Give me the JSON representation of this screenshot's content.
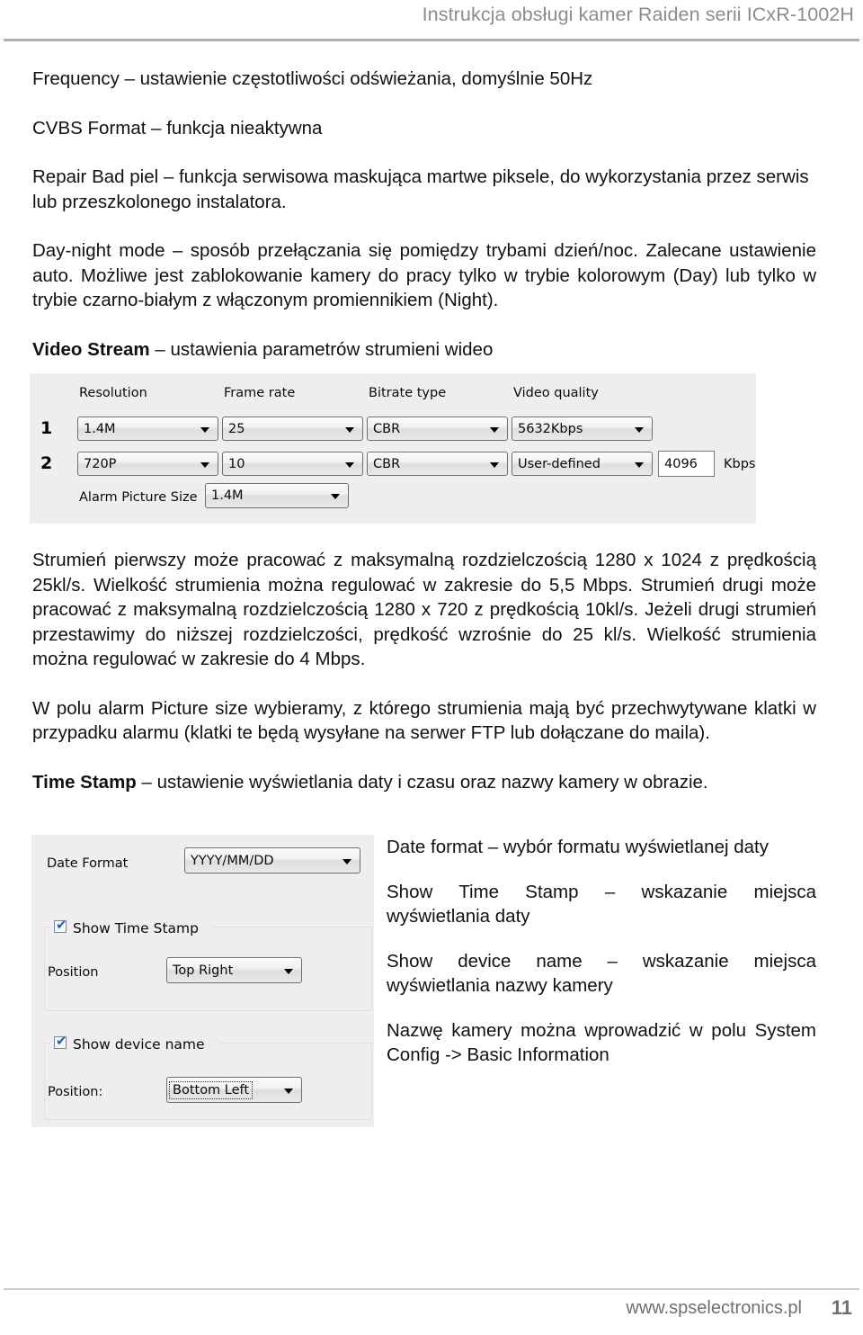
{
  "header": {
    "title": "Instrukcja obsługi kamer Raiden serii ICxR-1002H"
  },
  "body": {
    "p_frequency": "Frequency – ustawienie częstotliwości odświeżania, domyślnie 50Hz",
    "p_cvbs": "CVBS Format – funkcja nieaktywna",
    "p_repair": "Repair Bad piel – funkcja serwisowa maskująca martwe piksele, do wykorzystania przez serwis lub przeszkolonego instalatora.",
    "p_daynight": "Day-night mode – sposób przełączania się pomiędzy trybami dzień/noc. Zalecane ustawienie auto. Możliwe jest zablokowanie kamery do pracy tylko w trybie kolorowym (Day) lub tylko w trybie czarno-białym z włączonym promiennikiem (Night).",
    "video_stream_heading_bold": "Video Stream",
    "video_stream_heading_rest": " – ustawienia parametrów strumieni wideo",
    "p_streams": "Strumień pierwszy może pracować z maksymalną rozdzielczością 1280 x 1024 z prędkością 25kl/s. Wielkość strumienia można regulować w zakresie do 5,5 Mbps. Strumień drugi może pracować z maksymalną rozdzielczością 1280 x 720 z prędkością 10kl/s. Jeżeli drugi strumień przestawimy do niższej rozdzielczości, prędkość wzrośnie do 25 kl/s. Wielkość strumienia można regulować w zakresie do 4 Mbps.",
    "p_alarm_picture": "W polu alarm Picture size wybieramy, z którego strumienia mają być przechwytywane klatki w przypadku alarmu (klatki te będą wysyłane na serwer FTP lub dołączane do maila).",
    "time_stamp_heading_bold": "Time Stamp",
    "time_stamp_heading_rest": " – ustawienie wyświetlania daty i czasu oraz nazwy kamery w obrazie."
  },
  "video_stream_panel": {
    "columns": {
      "resolution": "Resolution",
      "frame_rate": "Frame rate",
      "bitrate_type": "Bitrate type",
      "video_quality": "Video quality"
    },
    "rows": [
      {
        "index": "1",
        "resolution": "1.4M",
        "frame_rate": "25",
        "bitrate_type": "CBR",
        "video_quality": "5632Kbps"
      },
      {
        "index": "2",
        "resolution": "720P",
        "frame_rate": "10",
        "bitrate_type": "CBR",
        "video_quality": "User-defined",
        "custom_bitrate": "4096",
        "custom_bitrate_unit": "Kbps"
      }
    ],
    "alarm_picture_size_label": "Alarm Picture Size",
    "alarm_picture_size_value": "1.4M"
  },
  "time_stamp_panel": {
    "date_format_label": "Date Format",
    "date_format_value": "YYYY/MM/DD",
    "show_time_stamp_label": "Show Time Stamp",
    "time_stamp_position_label": "Position",
    "time_stamp_position_value": "Top Right",
    "show_device_name_label": "Show device name",
    "device_name_position_label": "Position:",
    "device_name_position_value": "Bottom Left",
    "checkbox_tick": "✔"
  },
  "right_column": {
    "date_format_desc": "Date format – wybór formatu wyświetlanej daty",
    "show_time_stamp_desc": "Show Time Stamp – wskazanie miejsca wyświetlania daty",
    "show_device_name_desc": "Show device name – wskazanie miejsca wyświetlania nazwy kamery",
    "camera_name_desc": "Nazwę kamery można wprowadzić w polu System Config -> Basic Information"
  },
  "footer": {
    "website": "www.spselectronics.pl",
    "page_number": "11"
  }
}
